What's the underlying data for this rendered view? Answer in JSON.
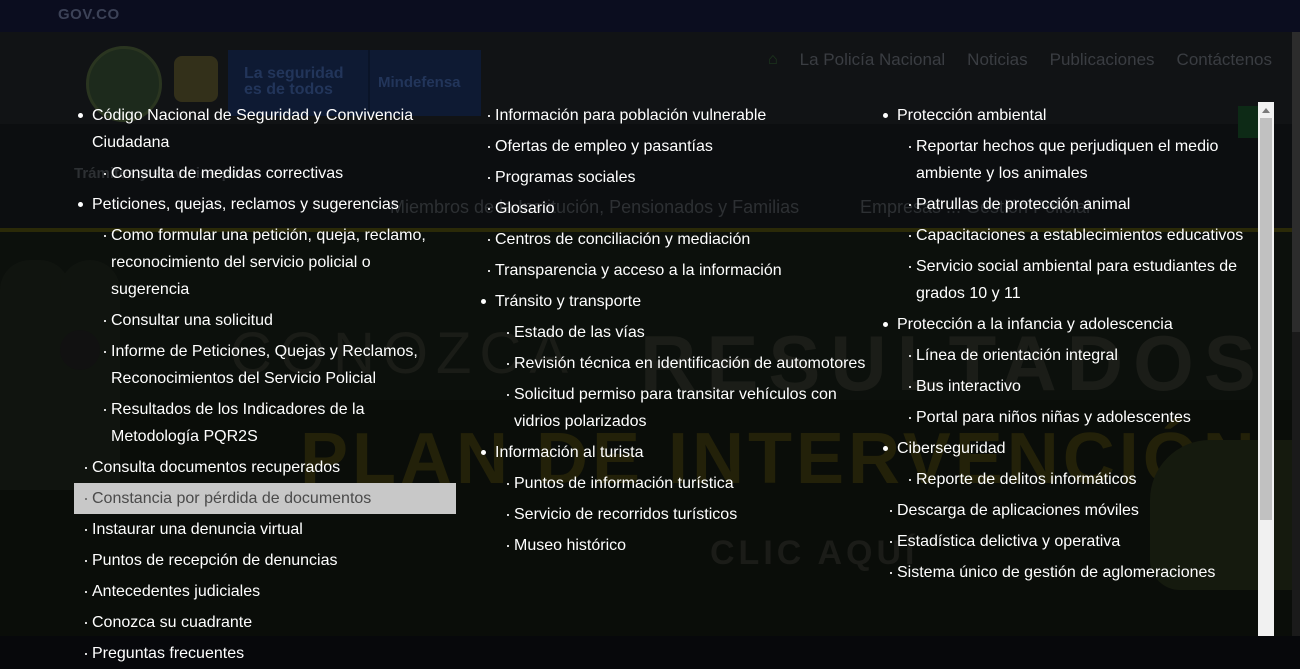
{
  "background": {
    "gov_logo": "GOV.CO",
    "brand_text": "La seguridad es de todos",
    "ministry": "Mindefensa",
    "top_nav": [
      "La Policía Nacional",
      "Noticias",
      "Publicaciones",
      "Contáctenos"
    ],
    "subbar_left": "Trámites y servicios para:",
    "subbar_mid": "Miembros de la Institución, Pensionados y Familias",
    "subbar_right": "Empresas ... Gestión Policial",
    "hero_conozca": "CONOZCA",
    "hero_los": "LOS",
    "hero_resultados": "RESULTADOS",
    "hero_plan": "PLAN DE INTERVENCIÓN",
    "hero_clic": "CLIC AQUÍ"
  },
  "menu": {
    "col1": [
      {
        "label": "Código Nacional de Seguridad y Convivencia Ciudadana",
        "level": 1
      },
      {
        "label": "Consulta de medidas correctivas",
        "level": 2
      },
      {
        "label": "Peticiones, quejas, reclamos y sugerencias",
        "level": 1
      },
      {
        "label": "Como formular una petición, queja, reclamo, reconocimiento del servicio policial o sugerencia",
        "level": 2
      },
      {
        "label": "Consultar una solicitud",
        "level": 2
      },
      {
        "label": "Informe de Peticiones, Quejas y Reclamos, Reconocimientos del Servicio Policial",
        "level": 2
      },
      {
        "label": "Resultados de los Indicadores de la Metodología PQR2S",
        "level": 2
      },
      {
        "label": "Consulta documentos recuperados",
        "level": 0
      },
      {
        "label": "Constancia por pérdida de documentos",
        "level": 0,
        "highlight": true
      },
      {
        "label": "Instaurar una denuncia virtual",
        "level": 0
      },
      {
        "label": "Puntos de recepción de denuncias",
        "level": 0
      },
      {
        "label": "Antecedentes judiciales",
        "level": 0
      },
      {
        "label": "Conozca su cuadrante",
        "level": 0
      },
      {
        "label": "Preguntas frecuentes",
        "level": 0
      }
    ],
    "col2": [
      {
        "label": "Información para población vulnerable",
        "level": 0
      },
      {
        "label": "Ofertas de empleo y pasantías",
        "level": 0
      },
      {
        "label": "Programas sociales",
        "level": 0
      },
      {
        "label": "Glosario",
        "level": 0
      },
      {
        "label": "Centros de conciliación y mediación",
        "level": 0
      },
      {
        "label": "Transparencia y acceso a la información",
        "level": 0
      },
      {
        "label": "Tránsito y transporte",
        "level": 1
      },
      {
        "label": "Estado de las vías",
        "level": 2
      },
      {
        "label": "Revisión técnica en identificación de automotores",
        "level": 2
      },
      {
        "label": "Solicitud permiso para transitar vehículos con vidrios polarizados",
        "level": 2
      },
      {
        "label": "Información al turista",
        "level": 1
      },
      {
        "label": "Puntos de información turística",
        "level": 2
      },
      {
        "label": "Servicio de recorridos turísticos",
        "level": 2
      },
      {
        "label": "Museo histórico",
        "level": 2
      }
    ],
    "col3": [
      {
        "label": "Protección ambiental",
        "level": 1
      },
      {
        "label": "Reportar hechos que perjudiquen el medio ambiente y los animales",
        "level": 2
      },
      {
        "label": "Patrullas de protección animal",
        "level": 2
      },
      {
        "label": "Capacitaciones a establecimientos educativos",
        "level": 2
      },
      {
        "label": "Servicio social ambiental para estudiantes de grados 10 y 11",
        "level": 2
      },
      {
        "label": "Protección a la infancia y adolescencia",
        "level": 1
      },
      {
        "label": "Línea de orientación integral",
        "level": 2
      },
      {
        "label": "Bus interactivo",
        "level": 2
      },
      {
        "label": "Portal para niños niñas y adolescentes",
        "level": 2
      },
      {
        "label": "Ciberseguridad",
        "level": 1
      },
      {
        "label": "Reporte de delitos informáticos",
        "level": 2
      },
      {
        "label": "Descarga de aplicaciones móviles",
        "level": 0
      },
      {
        "label": "Estadística delictiva y operativa",
        "level": 0
      },
      {
        "label": "Sistema único de gestión de aglomeraciones",
        "level": 0
      }
    ]
  },
  "colors": {
    "overlay": "#07080b",
    "menu_text": "#ffffff",
    "highlight_bg": "#c8c8c8",
    "highlight_text": "#4a4a4a",
    "scrollbar_track": "#f1f1f1",
    "scrollbar_thumb": "#c1c1c1"
  }
}
